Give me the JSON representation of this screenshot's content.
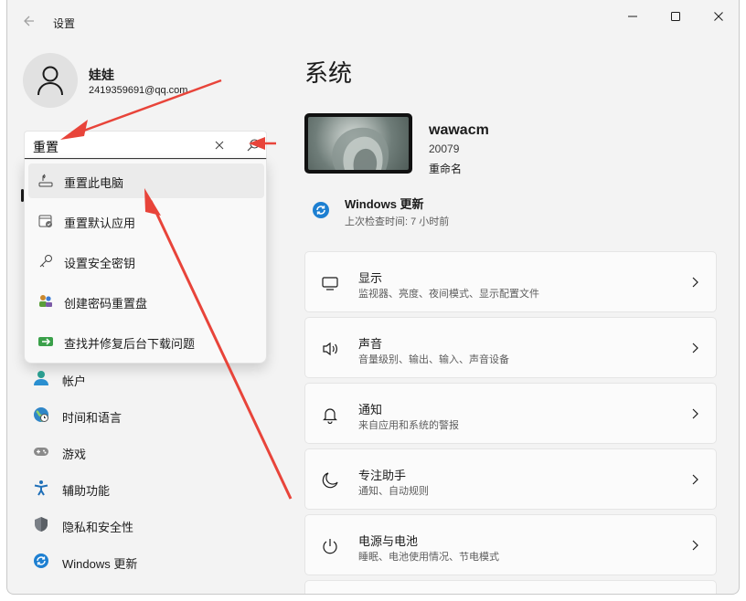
{
  "window": {
    "title": "设置",
    "controls": {
      "minimize_icon": "minimize-icon",
      "maximize_icon": "maximize-icon",
      "close_icon": "close-icon"
    }
  },
  "profile": {
    "name": "娃娃",
    "email": "2419359691@qq.com"
  },
  "search": {
    "value": "重置",
    "results": [
      {
        "label": "重置此电脑",
        "icon": "reset-pc-icon"
      },
      {
        "label": "重置默认应用",
        "icon": "default-apps-icon"
      },
      {
        "label": "设置安全密钥",
        "icon": "key-icon"
      },
      {
        "label": "创建密码重置盘",
        "icon": "password-reset-disk-icon"
      },
      {
        "label": "查找并修复后台下载问题",
        "icon": "download-fix-icon"
      }
    ]
  },
  "nav": {
    "items": [
      {
        "label": "帐户",
        "icon": "account-icon"
      },
      {
        "label": "时间和语言",
        "icon": "time-language-icon"
      },
      {
        "label": "游戏",
        "icon": "gaming-icon"
      },
      {
        "label": "辅助功能",
        "icon": "accessibility-icon"
      },
      {
        "label": "隐私和安全性",
        "icon": "privacy-shield-icon"
      },
      {
        "label": "Windows 更新",
        "icon": "windows-update-icon"
      }
    ]
  },
  "main": {
    "title": "系统",
    "device": {
      "name": "wawacm",
      "model": "20079",
      "rename": "重命名"
    },
    "windows_update": {
      "title": "Windows 更新",
      "subtitle": "上次检查时间: 7 小时前"
    },
    "cards": [
      {
        "title": "显示",
        "subtitle": "监视器、亮度、夜间模式、显示配置文件",
        "icon": "display-icon"
      },
      {
        "title": "声音",
        "subtitle": "音量级别、输出、输入、声音设备",
        "icon": "speaker-icon"
      },
      {
        "title": "通知",
        "subtitle": "来自应用和系统的警报",
        "icon": "bell-icon"
      },
      {
        "title": "专注助手",
        "subtitle": "通知、自动规则",
        "icon": "moon-icon"
      },
      {
        "title": "电源与电池",
        "subtitle": "睡眠、电池使用情况、节电模式",
        "icon": "power-icon"
      }
    ]
  },
  "colors": {
    "accent": "#0067c0",
    "arrow": "#e8443a",
    "background": "#f3f3f3"
  }
}
